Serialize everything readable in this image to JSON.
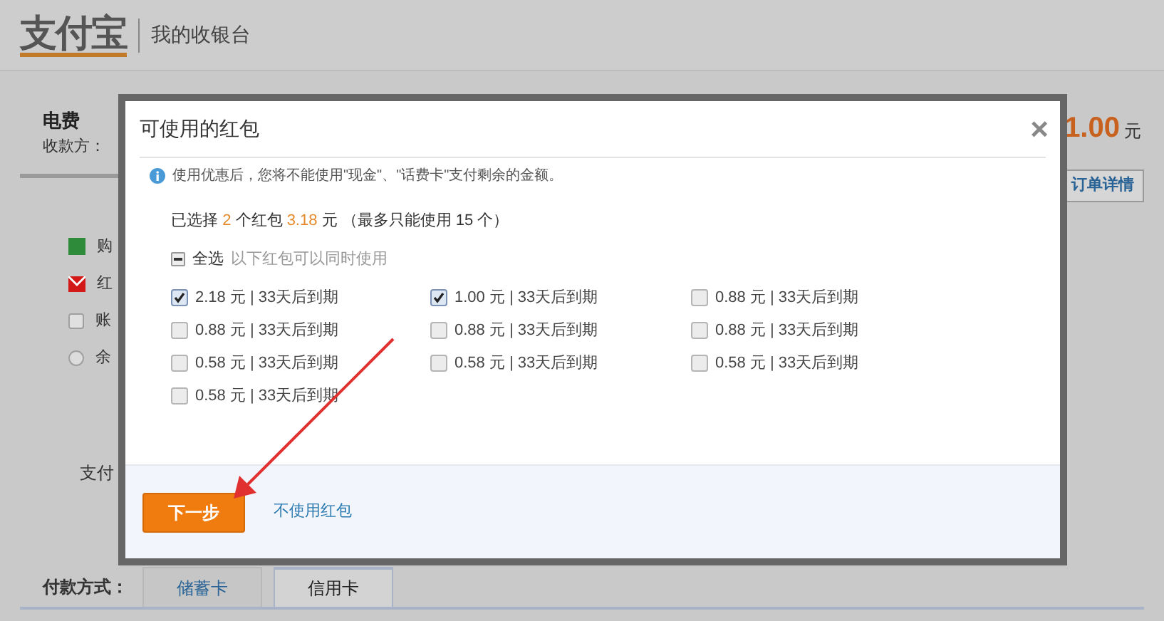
{
  "header": {
    "logo": "支付宝",
    "title": "我的收银台"
  },
  "order": {
    "name": "电费",
    "payee": "收款方：",
    "amount": "1.00",
    "currency": "元",
    "details_tab": "订单详情"
  },
  "methods": [
    {
      "kind": "card",
      "label": "购"
    },
    {
      "kind": "envelope",
      "label": "红"
    },
    {
      "kind": "checkbox",
      "label": "账",
      "checked": false
    },
    {
      "kind": "radio",
      "label": "余",
      "selected": false
    }
  ],
  "pay_label": "支付",
  "payment_tabs": {
    "label": "付款方式：",
    "tabs": [
      {
        "label": "储蓄卡",
        "selected": false
      },
      {
        "label": "信用卡",
        "selected": true
      }
    ]
  },
  "dialog": {
    "title": "可使用的红包",
    "close": "×",
    "notice": "使用优惠后，您将不能使用\"现金\"、\"话费卡\"支付剩余的金额。",
    "summary": {
      "prefix": "已选择",
      "count": "2",
      "middle": "个红包",
      "amount": "3.18",
      "suffix": "元 （最多只能使用 15 个）"
    },
    "select_all": {
      "label": "全选",
      "hint": "以下红包可以同时使用",
      "indeterminate": true
    },
    "envelopes": [
      {
        "label": "2.18 元 | 33天后到期",
        "checked": true
      },
      {
        "label": "1.00 元 | 33天后到期",
        "checked": true
      },
      {
        "label": "0.88 元 | 33天后到期",
        "checked": false
      },
      {
        "label": "0.88 元 | 33天后到期",
        "checked": false
      },
      {
        "label": "0.88 元 | 33天后到期",
        "checked": false
      },
      {
        "label": "0.88 元 | 33天后到期",
        "checked": false
      },
      {
        "label": "0.58 元 | 33天后到期",
        "checked": false
      },
      {
        "label": "0.58 元 | 33天后到期",
        "checked": false
      },
      {
        "label": "0.58 元 | 33天后到期",
        "checked": false
      },
      {
        "label": "0.58 元 | 33天后到期",
        "checked": false
      }
    ],
    "next_button": "下一步",
    "skip_link": "不使用红包"
  }
}
